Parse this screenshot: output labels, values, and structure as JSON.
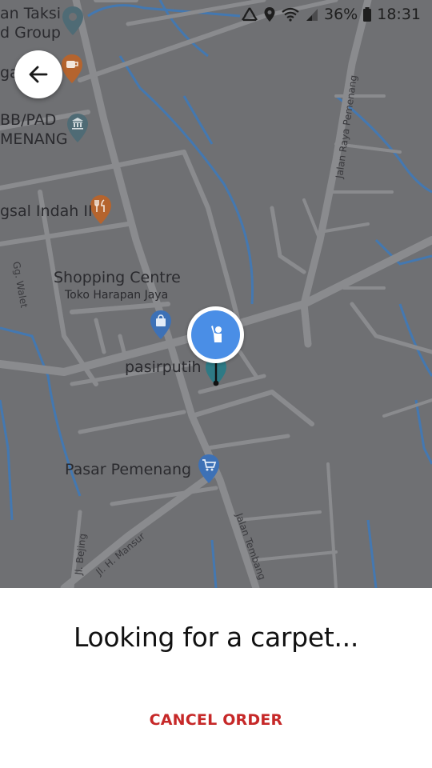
{
  "status_bar": {
    "battery": "36%",
    "time": "18:31"
  },
  "map": {
    "labels": {
      "taksi_line1": "an Taksi",
      "taksi_line2": "d Group",
      "cafe_partial": "ga",
      "bb_line1": "BB/PAD",
      "bb_line2": "MENANG",
      "restaurant": "gsal Indah II",
      "shopping_line1": "Shopping Centre",
      "shopping_line2": "Toko Harapan Jaya",
      "pasirputih": "pasirputih",
      "pasar": "Pasar Pemenang",
      "road_raya": "Jalan Raya Pemenang",
      "road_walet": "Gg. Walet",
      "road_mansur": "Jl. H. Mansur",
      "road_bejing": "Jl. Bejing",
      "road_tembang": "Jalan Tembang"
    },
    "colors": {
      "land": "#6f7073",
      "road": "#8a8b8e",
      "water": "#3f79b8",
      "user_marker": "#4a8ee6"
    }
  },
  "sheet": {
    "status_text": "Looking for a carpet...",
    "cancel_label": "CANCEL ORDER",
    "cancel_color": "#c62828"
  }
}
